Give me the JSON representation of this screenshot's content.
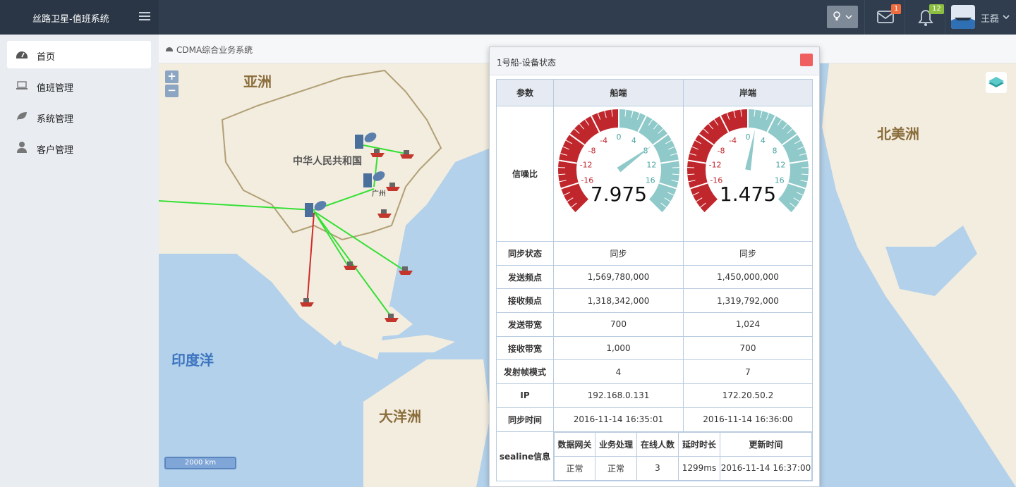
{
  "app": {
    "title": "丝路卫星-值班系统"
  },
  "header": {
    "mail_badge": "1",
    "bell_badge": "12",
    "user_name": "王磊",
    "colors": {
      "mail_badge": "#ef6c3e",
      "bell_badge": "#8cbf3f"
    }
  },
  "sidebar": {
    "items": [
      {
        "label": "首页",
        "icon": "dashboard-icon"
      },
      {
        "label": "值班管理",
        "icon": "laptop-icon"
      },
      {
        "label": "系统管理",
        "icon": "leaf-icon"
      },
      {
        "label": "客户管理",
        "icon": "user-icon"
      }
    ]
  },
  "breadcrumb": {
    "label": "CDMA综合业务系统"
  },
  "map": {
    "labels": {
      "asia": "亚洲",
      "china": "中华人民共和国",
      "north_america": "北美洲",
      "indian_ocean": "印度洋",
      "oceania": "大洋洲"
    },
    "zoom_in": "+",
    "zoom_out": "−",
    "scale": "2000 km",
    "station_label": "广州"
  },
  "dialog": {
    "title": "1号船-设备状态",
    "headers": {
      "param": "参数",
      "ship": "船端",
      "shore": "岸端"
    },
    "snr": {
      "label": "信噪比",
      "ship_value": "7.975",
      "shore_value": "1.475",
      "ship_num": 7.975,
      "shore_num": 1.475,
      "min": -20,
      "max": 20,
      "ticks": [
        "-16",
        "-12",
        "-8",
        "-4",
        "0",
        "4",
        "8",
        "12",
        "16"
      ]
    },
    "rows": [
      {
        "label": "同步状态",
        "ship": "同步",
        "shore": "同步"
      },
      {
        "label": "发送频点",
        "ship": "1,569,780,000",
        "shore": "1,450,000,000"
      },
      {
        "label": "接收频点",
        "ship": "1,318,342,000",
        "shore": "1,319,792,000"
      },
      {
        "label": "发送带宽",
        "ship": "700",
        "shore": "1,024"
      },
      {
        "label": "接收带宽",
        "ship": "1,000",
        "shore": "700"
      },
      {
        "label": "发射帧模式",
        "ship": "4",
        "shore": "7"
      },
      {
        "label": "IP",
        "ship": "192.168.0.131",
        "shore": "172.20.50.2"
      },
      {
        "label": "同步时间",
        "ship": "2016-11-14 16:35:01",
        "shore": "2016-11-14 16:36:00"
      }
    ],
    "sealine": {
      "label": "sealine信息",
      "headers": [
        "数据网关",
        "业务处理",
        "在线人数",
        "延时时长",
        "更新时间"
      ],
      "values": [
        "正常",
        "正常",
        "3",
        "1299ms",
        "2016-11-14 16:37:00"
      ]
    }
  }
}
